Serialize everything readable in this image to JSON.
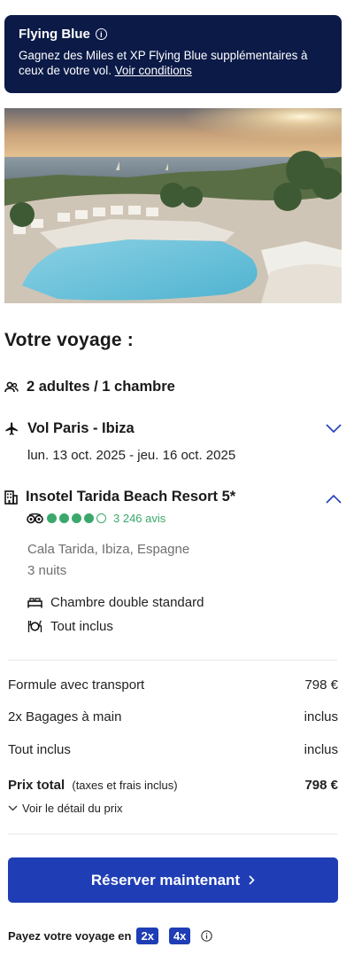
{
  "banner": {
    "title": "Flying Blue",
    "text": "Gagnez des Miles et XP Flying Blue supplémentaires à ceux de votre vol.",
    "link": "Voir conditions"
  },
  "trip": {
    "heading": "Votre voyage :",
    "travellers": "2 adultes / 1 chambre",
    "flight": {
      "title": "Vol Paris - Ibiza",
      "dates": "lun. 13 oct. 2025 - jeu. 16 oct. 2025"
    },
    "hotel": {
      "name": "Insotel Tarida Beach Resort 5*",
      "rating_filled": 4,
      "rating_total": 5,
      "reviews": "3 246 avis",
      "location": "Cala Tarida, Ibiza, Espagne",
      "nights": "3 nuits",
      "room": "Chambre double standard",
      "board": "Tout inclus"
    }
  },
  "pricing": {
    "rows": [
      {
        "label": "Formule avec transport",
        "value": "798 €"
      },
      {
        "label": "2x Bagages à main",
        "value": "inclus"
      },
      {
        "label": "Tout inclus",
        "value": "inclus"
      }
    ],
    "total_label": "Prix total",
    "total_note": "(taxes et frais inclus)",
    "total_value": "798 €",
    "detail_link": "Voir le détail du prix"
  },
  "cta": {
    "label": "Réserver maintenant"
  },
  "installments": {
    "text": "Payez votre voyage en",
    "option1": "2x",
    "option2": "4x"
  },
  "colors": {
    "brand_dark": "#0b1a47",
    "primary": "#1f3eb5",
    "rating_green": "#3aa86a"
  }
}
